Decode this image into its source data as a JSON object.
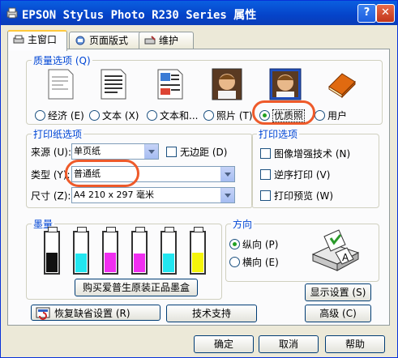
{
  "window": {
    "title": "EPSON Stylus Photo R230 Series 属性",
    "help_label": "?",
    "close_label": "✕"
  },
  "tabs": [
    {
      "label": "主窗口"
    },
    {
      "label": "页面版式"
    },
    {
      "label": "维护"
    }
  ],
  "quality": {
    "legend": "质量选项 (Q)",
    "options": [
      {
        "label": "经济 (E)",
        "icon": "economy-doc-icon"
      },
      {
        "label": "文本 (X)",
        "icon": "text-doc-icon"
      },
      {
        "label": "文本和...",
        "icon": "text-image-doc-icon"
      },
      {
        "label": "照片 (T)",
        "icon": "photo-icon"
      },
      {
        "label": "优质照",
        "icon": "best-photo-icon"
      },
      {
        "label": "用户",
        "icon": "custom-book-icon"
      }
    ],
    "selected": "优质照"
  },
  "paper": {
    "legend": "打印纸选项",
    "source_label": "来源 (U):",
    "source_value": "单页纸",
    "borderless_label": "无边距 (D)",
    "type_label": "类型 (Y):",
    "type_value": "普通纸",
    "size_label": "尺寸 (Z):",
    "size_value": "A4 210 x 297 毫米"
  },
  "print_options": {
    "legend": "打印选项",
    "items": [
      "图像增强技术 (N)",
      "逆序打印 (V)",
      "打印预览 (W)"
    ]
  },
  "ink": {
    "legend": "墨量",
    "levels": [
      0.85,
      0.8,
      0.85,
      0.8,
      0.8,
      0.85
    ],
    "colors": [
      "#111111",
      "#22e6f0",
      "#f02ef0",
      "#f02ef0",
      "#22e6f0",
      "#f5f50a"
    ],
    "buy_label": "购买爱普生原装正品墨盒"
  },
  "orientation": {
    "legend": "方向",
    "portrait": "纵向 (P)",
    "landscape": "横向 (E)",
    "selected": "纵向 (P)"
  },
  "buttons": {
    "display_settings": "显示设置 (S)",
    "restore_defaults": "恢复缺省设置 (R)",
    "tech_support": "技术支持",
    "advanced": "高级 (C)",
    "ok": "确定",
    "cancel": "取消",
    "help": "帮助"
  }
}
